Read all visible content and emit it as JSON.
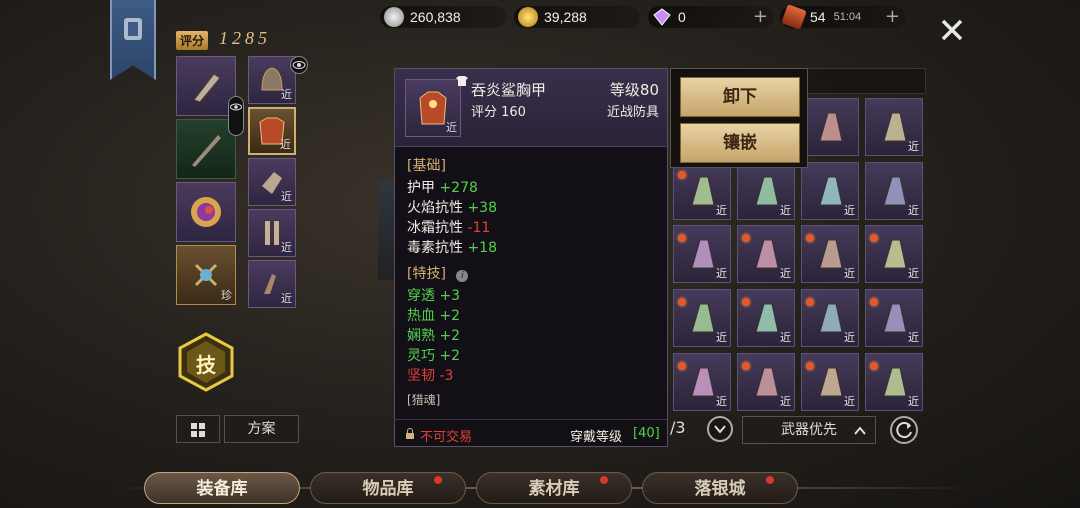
{
  "currency": {
    "silver": "260,838",
    "gold": "39,288",
    "gem": "0",
    "ticket": "54",
    "timer": "51:04"
  },
  "score": {
    "label": "评分",
    "value": "1285"
  },
  "equipped": {
    "near_label": "近",
    "rare_label": "珍"
  },
  "skill_button": "技",
  "preset_button": "方案",
  "tooltip": {
    "name": "吞炎鲨胸甲",
    "level": "等级80",
    "score": "评分 160",
    "type": "近战防具",
    "near": "近",
    "basic_header": "[基础]",
    "basic": [
      {
        "name": "护甲",
        "value": "+278"
      },
      {
        "name": "火焰抗性",
        "value": "+38"
      },
      {
        "name": "冰霜抗性",
        "value": "-11"
      },
      {
        "name": "毒素抗性",
        "value": "+18"
      }
    ],
    "skill_header": "[特技]",
    "skills": [
      {
        "name": "穿透",
        "value": "+3"
      },
      {
        "name": "热血",
        "value": "+2"
      },
      {
        "name": "娴熟",
        "value": "+2"
      },
      {
        "name": "灵巧",
        "value": "+2"
      },
      {
        "name": "坚韧",
        "value": "-3"
      }
    ],
    "set_label": "[猎魂]",
    "trade": "不可交易",
    "wear_level_label": "穿戴等级",
    "wear_level_value": "[40]"
  },
  "popup": {
    "unequip": "卸下",
    "inlay": "镶嵌"
  },
  "inventory": {
    "page": "/3",
    "sort": "武器优先",
    "near_label": "近"
  },
  "tabs": [
    "装备库",
    "物品库",
    "素材库",
    "落银城"
  ],
  "close_icon": "close-icon"
}
